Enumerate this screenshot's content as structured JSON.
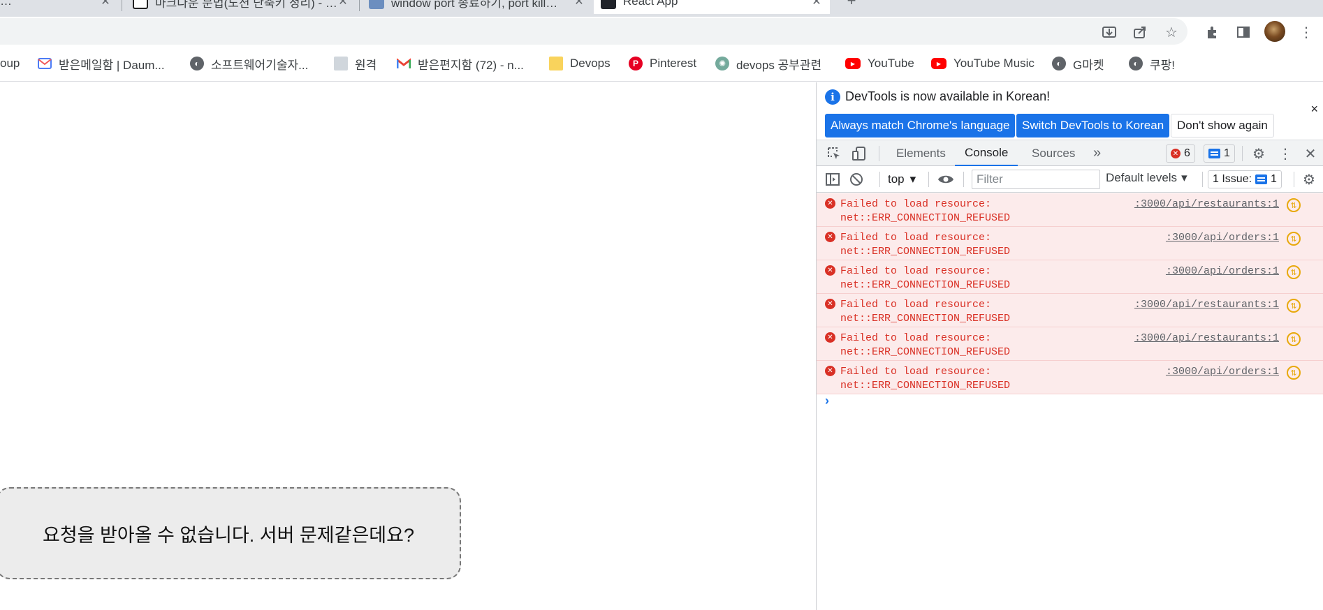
{
  "tabs": [
    {
      "title": "…",
      "active": false
    },
    {
      "title": "마크다운 문법(노션 단축키 정리) - …",
      "active": false
    },
    {
      "title": "window port 종료하기, port kill…",
      "active": false
    },
    {
      "title": "React App",
      "active": true
    }
  ],
  "new_tab_glyph": "+",
  "bookmarks": [
    {
      "label": "oup",
      "icon": "folder-icon"
    },
    {
      "label": "받은메일함 | Daum...",
      "icon": "daum-mail-icon"
    },
    {
      "label": "소프트웨어기술자...",
      "icon": "globe-icon"
    },
    {
      "label": "원격",
      "icon": "remote-icon"
    },
    {
      "label": "받은편지함 (72) - n...",
      "icon": "gmail-icon"
    },
    {
      "label": "Devops",
      "icon": "folder-icon"
    },
    {
      "label": "Pinterest",
      "icon": "pinterest-icon"
    },
    {
      "label": "devops 공부관련",
      "icon": "chatgpt-icon"
    },
    {
      "label": "YouTube",
      "icon": "youtube-icon"
    },
    {
      "label": "YouTube Music",
      "icon": "youtube-icon"
    },
    {
      "label": "G마켓",
      "icon": "globe-icon"
    },
    {
      "label": "쿠팡!",
      "icon": "globe-icon"
    }
  ],
  "page": {
    "error_message": "요청을 받아올 수 없습니다. 서버 문제같은데요?"
  },
  "devtools": {
    "infobar": {
      "text": "DevTools is now available in Korean!",
      "buttons": [
        "Always match Chrome's language",
        "Switch DevTools to Korean",
        "Don't show again"
      ],
      "close": "×"
    },
    "tabs": [
      "Elements",
      "Console",
      "Sources"
    ],
    "active_tab": "Console",
    "more_tabs": "»",
    "error_count": "6",
    "message_count": "1",
    "console_toolbar": {
      "context": "top",
      "filter_placeholder": "Filter",
      "levels": "Default levels",
      "issues_label": "1 Issue:",
      "issues_count": "1"
    },
    "logs": [
      {
        "line1": "Failed to load resource:",
        "line2": "net::ERR_CONNECTION_REFUSED",
        "source": ":3000/api/restaurants:1"
      },
      {
        "line1": "Failed to load resource:",
        "line2": "net::ERR_CONNECTION_REFUSED",
        "source": ":3000/api/orders:1"
      },
      {
        "line1": "Failed to load resource:",
        "line2": "net::ERR_CONNECTION_REFUSED",
        "source": ":3000/api/orders:1"
      },
      {
        "line1": "Failed to load resource:",
        "line2": "net::ERR_CONNECTION_REFUSED",
        "source": ":3000/api/restaurants:1"
      },
      {
        "line1": "Failed to load resource:",
        "line2": "net::ERR_CONNECTION_REFUSED",
        "source": ":3000/api/restaurants:1"
      },
      {
        "line1": "Failed to load resource:",
        "line2": "net::ERR_CONNECTION_REFUSED",
        "source": ":3000/api/orders:1"
      }
    ],
    "prompt_glyph": "›"
  },
  "colors": {
    "accent": "#1a73e8",
    "error": "#d93025",
    "error_row_bg": "#fcebeb"
  }
}
